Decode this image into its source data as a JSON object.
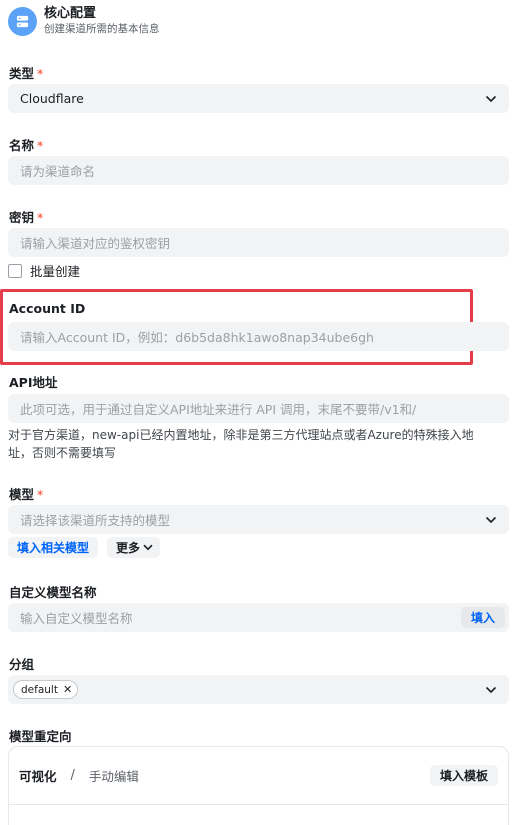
{
  "header": {
    "title": "核心配置",
    "subtitle": "创建渠道所需的基本信息",
    "icon": "server-icon"
  },
  "type": {
    "label": "类型",
    "required": "*",
    "value": "Cloudflare"
  },
  "name": {
    "label": "名称",
    "required": "*",
    "placeholder": "请为渠道命名"
  },
  "key": {
    "label": "密钥",
    "required": "*",
    "placeholder": "请输入渠道对应的鉴权密钥",
    "batch_create_label": "批量创建"
  },
  "account_id": {
    "label": "Account ID",
    "placeholder": "请输入Account ID，例如：d6b5da8hk1awo8nap34ube6gh"
  },
  "api_address": {
    "label": "API地址",
    "placeholder": "此项可选，用于通过自定义API地址来进行 API 调用，末尾不要带/v1和/",
    "help_line1": "对于官方渠道，new-api已经内置地址，除非是第三方代理站点或者Azure的特殊接入地",
    "help_line2": "址，否则不需要填写"
  },
  "models": {
    "label": "模型",
    "required": "*",
    "placeholder": "请选择该渠道所支持的模型",
    "fill_related_label": "填入相关模型",
    "more_label": "更多"
  },
  "custom_model": {
    "label": "自定义模型名称",
    "placeholder": "输入自定义模型名称",
    "fill_label": "填入"
  },
  "group": {
    "label": "分组",
    "tags": [
      "default"
    ]
  },
  "model_redirect": {
    "label": "模型重定向",
    "tab_visual": "可视化",
    "separator": "/",
    "tab_manual": "手动编辑",
    "fill_template_label": "填入模板"
  },
  "colors": {
    "accent": "#0064fa",
    "required": "#f93920",
    "highlight": "#e53e4a",
    "header_icon_bg": "#5aa3f7"
  }
}
